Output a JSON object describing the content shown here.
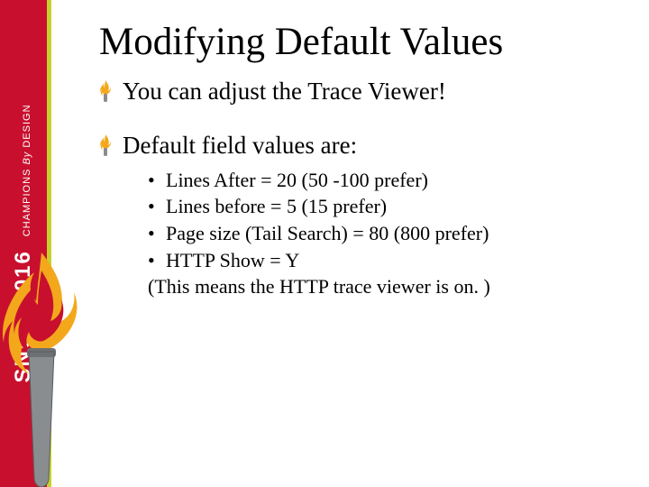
{
  "sidebar": {
    "brand_main": "SNUG 2016",
    "brand_sub_prefix": "CHAMPIONS ",
    "brand_sub_em": "By",
    "brand_sub_suffix": " DESIGN"
  },
  "title": "Modifying Default Values",
  "bullets": [
    {
      "text": "You can adjust the Trace Viewer!"
    },
    {
      "text": "Default field values are:",
      "subs": [
        "Lines After = 20 (50 -100 prefer)",
        "Lines before = 5 (15   prefer)",
        "Page size (Tail Search) = 80 (800 prefer)",
        "HTTP Show = Y"
      ],
      "note": "(This means the HTTP trace viewer is on. )"
    }
  ]
}
